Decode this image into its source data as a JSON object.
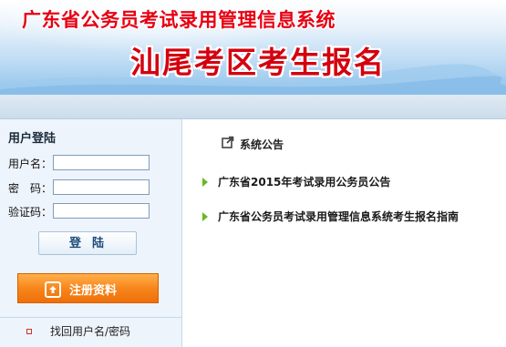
{
  "banner": {
    "title": "广东省公务员考试录用管理信息系统",
    "subtitle": "汕尾考区考生报名"
  },
  "login": {
    "title": "用户登陆",
    "username_label": "用户名：",
    "password_label": "密　码：",
    "captcha_label": "验证码：",
    "username_value": "",
    "password_value": "",
    "captcha_value": "",
    "login_button": "登陆",
    "register_button": "注册资料",
    "find_account": "找回用户名/密码"
  },
  "notice": {
    "heading": "系统公告",
    "items": [
      "广东省2015年考试录用公务员公告",
      "广东省公务员考试录用管理信息系统考生报名指南"
    ]
  },
  "colors": {
    "title_red": "#e60012",
    "register_orange": "#f7861c",
    "bullet_green": "#6ab821"
  },
  "icons": {
    "notice": "external-link-icon",
    "register": "upload-arrow-icon",
    "news_bullet": "green-triangle-icon"
  }
}
